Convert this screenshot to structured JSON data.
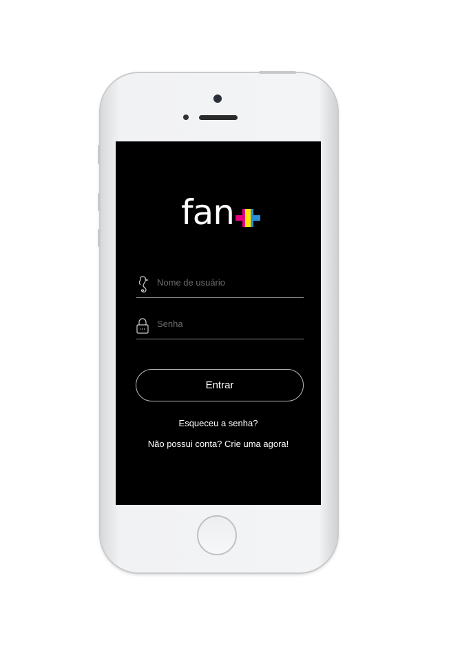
{
  "app": {
    "logo_text": "fan",
    "logo_symbol": "+"
  },
  "login": {
    "username_placeholder": "Nome de usuário",
    "password_placeholder": "Senha",
    "submit_label": "Entrar",
    "forgot_password": "Esqueceu a senha?",
    "signup_prompt": "Não possui conta? Crie uma agora!"
  },
  "colors": {
    "plus_left": "#e6007e",
    "plus_center": "#ffe600",
    "plus_right": "#2a8fd6"
  }
}
